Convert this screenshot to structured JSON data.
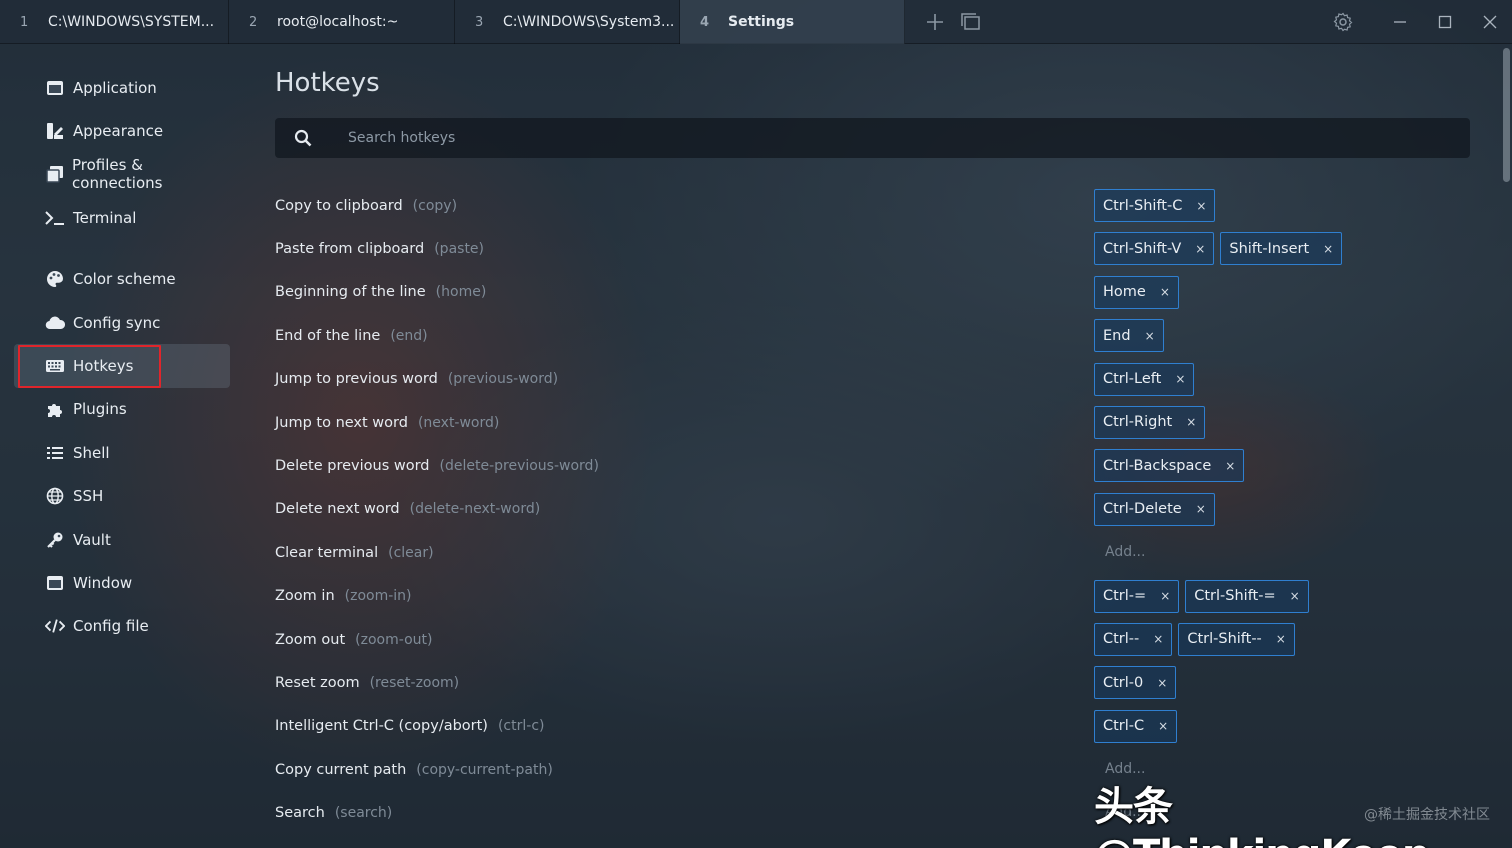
{
  "tabs": [
    {
      "num": "1",
      "label": "C:\\WINDOWS\\SYSTEM..."
    },
    {
      "num": "2",
      "label": "root@localhost:~"
    },
    {
      "num": "3",
      "label": "C:\\WINDOWS\\System3..."
    },
    {
      "num": "4",
      "label": "Settings"
    }
  ],
  "sidebar": {
    "items": [
      {
        "label": "Application",
        "icon": "window-icon"
      },
      {
        "label": "Appearance",
        "icon": "paint-icon"
      },
      {
        "label": "Profiles & connections",
        "icon": "profiles-icon"
      },
      {
        "label": "Terminal",
        "icon": "terminal-icon"
      },
      {
        "label": "Color scheme",
        "icon": "palette-icon"
      },
      {
        "label": "Config sync",
        "icon": "cloud-icon"
      },
      {
        "label": "Hotkeys",
        "icon": "keyboard-icon"
      },
      {
        "label": "Plugins",
        "icon": "puzzle-icon"
      },
      {
        "label": "Shell",
        "icon": "list-icon"
      },
      {
        "label": "SSH",
        "icon": "globe-icon"
      },
      {
        "label": "Vault",
        "icon": "key-icon"
      },
      {
        "label": "Window",
        "icon": "window-icon"
      },
      {
        "label": "Config file",
        "icon": "code-icon"
      }
    ]
  },
  "main": {
    "title": "Hotkeys",
    "search_placeholder": "Search hotkeys",
    "add_label": "Add...",
    "remove_symbol": "×",
    "hotkeys": [
      {
        "name": "Copy to clipboard",
        "id": "(copy)",
        "keys": [
          "Ctrl-Shift-C"
        ]
      },
      {
        "name": "Paste from clipboard",
        "id": "(paste)",
        "keys": [
          "Ctrl-Shift-V",
          "Shift-Insert"
        ]
      },
      {
        "name": "Beginning of the line",
        "id": "(home)",
        "keys": [
          "Home"
        ]
      },
      {
        "name": "End of the line",
        "id": "(end)",
        "keys": [
          "End"
        ]
      },
      {
        "name": "Jump to previous word",
        "id": "(previous-word)",
        "keys": [
          "Ctrl-Left"
        ]
      },
      {
        "name": "Jump to next word",
        "id": "(next-word)",
        "keys": [
          "Ctrl-Right"
        ]
      },
      {
        "name": "Delete previous word",
        "id": "(delete-previous-word)",
        "keys": [
          "Ctrl-Backspace"
        ]
      },
      {
        "name": "Delete next word",
        "id": "(delete-next-word)",
        "keys": [
          "Ctrl-Delete"
        ]
      },
      {
        "name": "Clear terminal",
        "id": "(clear)",
        "keys": []
      },
      {
        "name": "Zoom in",
        "id": "(zoom-in)",
        "keys": [
          "Ctrl-=",
          "Ctrl-Shift-="
        ]
      },
      {
        "name": "Zoom out",
        "id": "(zoom-out)",
        "keys": [
          "Ctrl--",
          "Ctrl-Shift--"
        ]
      },
      {
        "name": "Reset zoom",
        "id": "(reset-zoom)",
        "keys": [
          "Ctrl-0"
        ]
      },
      {
        "name": "Intelligent Ctrl-C (copy/abort)",
        "id": "(ctrl-c)",
        "keys": [
          "Ctrl-C"
        ]
      },
      {
        "name": "Copy current path",
        "id": "(copy-current-path)",
        "keys": []
      },
      {
        "name": "Search",
        "id": "(search)",
        "keys": []
      }
    ]
  },
  "watermark": {
    "text": "头条 @ThinkingKeep",
    "sub": "@稀土掘金技术社区"
  }
}
